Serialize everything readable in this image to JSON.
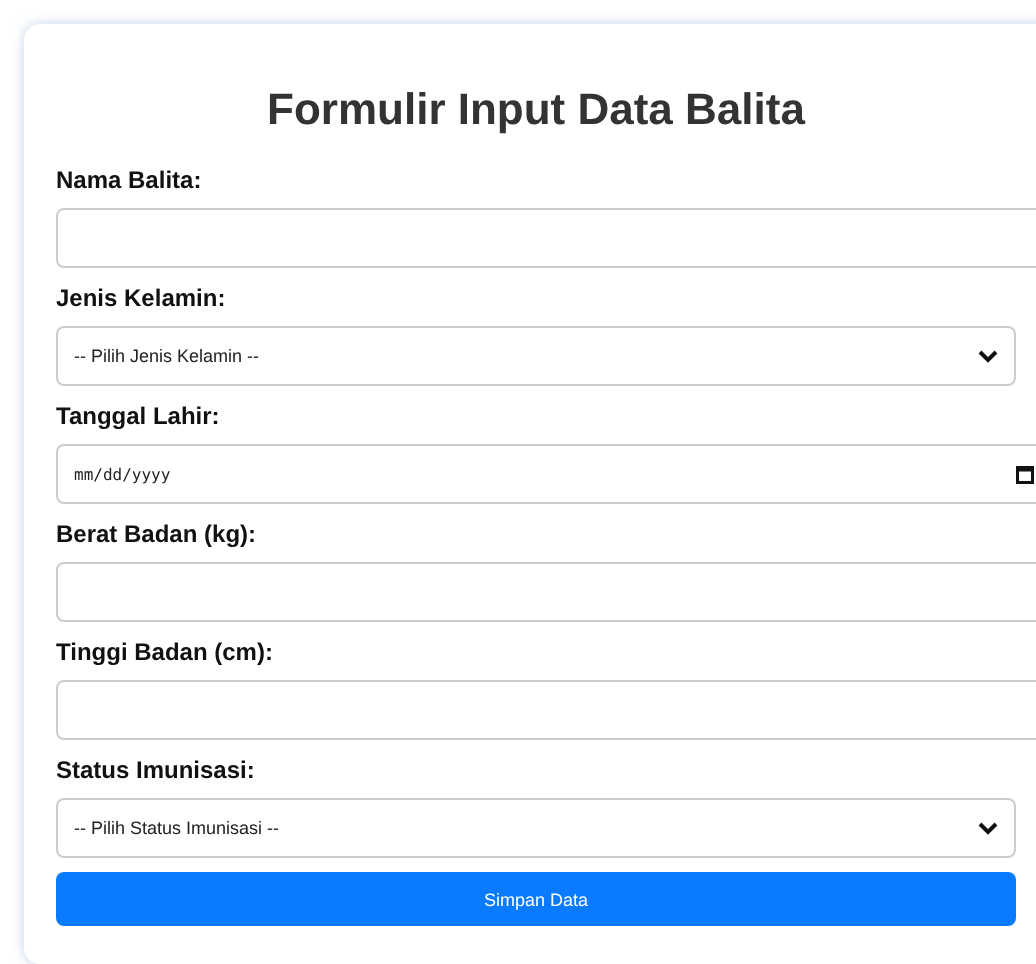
{
  "form": {
    "title": "Formulir Input Data Balita",
    "fields": [
      {
        "kind": "text",
        "label": "Nama Balita:"
      },
      {
        "kind": "select",
        "label": "Jenis Kelamin:",
        "value": "-- Pilih Jenis Kelamin --"
      },
      {
        "kind": "date",
        "label": "Tanggal Lahir:",
        "value": "mm/dd/yyyy"
      },
      {
        "kind": "text",
        "label": "Berat Badan (kg):"
      },
      {
        "kind": "text",
        "label": "Tinggi Badan (cm):"
      },
      {
        "kind": "select",
        "label": "Status Imunisasi:",
        "value": "-- Pilih Status Imunisasi --"
      }
    ],
    "submit": "Simpan Data"
  }
}
